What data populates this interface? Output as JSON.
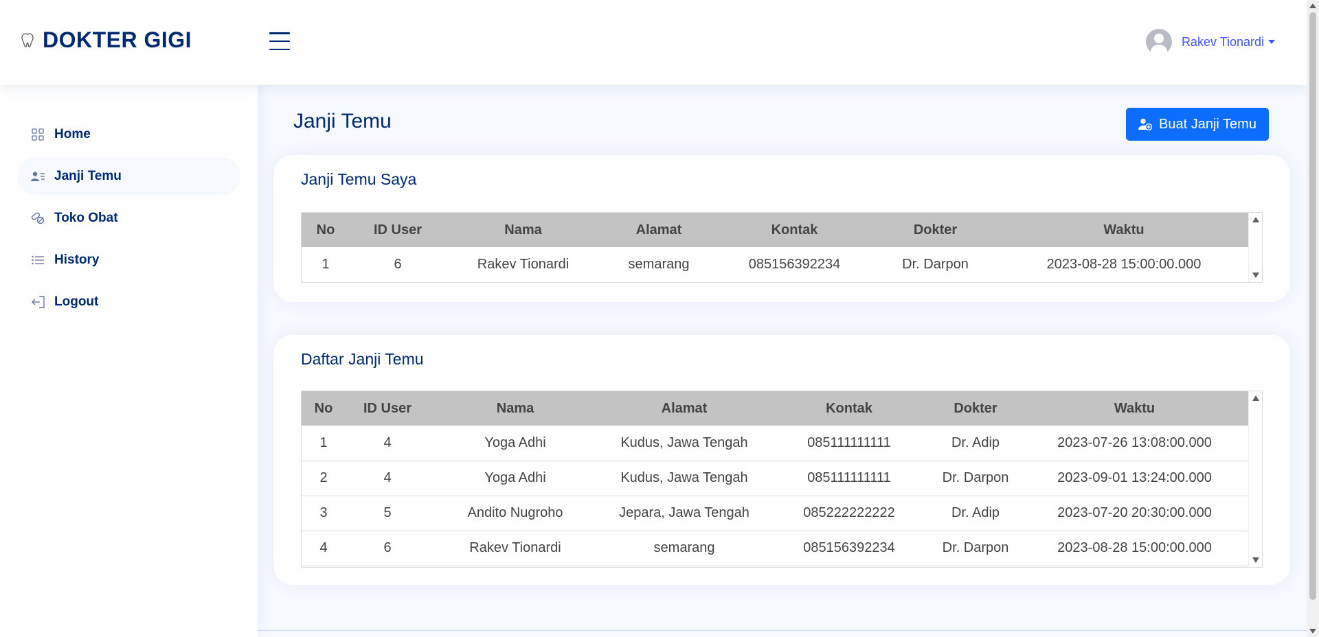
{
  "app": {
    "title": "DOKTER GIGI"
  },
  "header": {
    "user_name": "Rakev Tionardi"
  },
  "sidebar": {
    "items": [
      {
        "label": "Home",
        "icon": "grid-icon",
        "active": false
      },
      {
        "label": "Janji Temu",
        "icon": "user-list-icon",
        "active": true
      },
      {
        "label": "Toko Obat",
        "icon": "pills-icon",
        "active": false
      },
      {
        "label": "History",
        "icon": "list-icon",
        "active": false
      },
      {
        "label": "Logout",
        "icon": "logout-icon",
        "active": false
      }
    ]
  },
  "main": {
    "page_title": "Janji Temu",
    "create_button": "Buat Janji Temu",
    "my_appointments": {
      "title": "Janji Temu Saya",
      "columns": [
        "No",
        "ID User",
        "Nama",
        "Alamat",
        "Kontak",
        "Dokter",
        "Waktu"
      ],
      "rows": [
        [
          "1",
          "6",
          "Rakev Tionardi",
          "semarang",
          "085156392234",
          "Dr. Darpon",
          "2023-08-28 15:00:00.000"
        ]
      ]
    },
    "all_appointments": {
      "title": "Daftar Janji Temu",
      "columns": [
        "No",
        "ID User",
        "Nama",
        "Alamat",
        "Kontak",
        "Dokter",
        "Waktu"
      ],
      "rows": [
        [
          "1",
          "4",
          "Yoga Adhi",
          "Kudus, Jawa Tengah",
          "085111111111",
          "Dr. Adip",
          "2023-07-26 13:08:00.000"
        ],
        [
          "2",
          "4",
          "Yoga Adhi",
          "Kudus, Jawa Tengah",
          "085111111111",
          "Dr. Darpon",
          "2023-09-01 13:24:00.000"
        ],
        [
          "3",
          "5",
          "Andito Nugroho",
          "Jepara, Jawa Tengah",
          "085222222222",
          "Dr. Adip",
          "2023-07-20 20:30:00.000"
        ],
        [
          "4",
          "6",
          "Rakev Tionardi",
          "semarang",
          "085156392234",
          "Dr. Darpon",
          "2023-08-28 15:00:00.000"
        ]
      ]
    }
  },
  "colors": {
    "primary": "#012970",
    "accent": "#4154f1",
    "button": "#0d6efd",
    "background": "#f6f9ff",
    "table_header": "#c3c3c3"
  }
}
